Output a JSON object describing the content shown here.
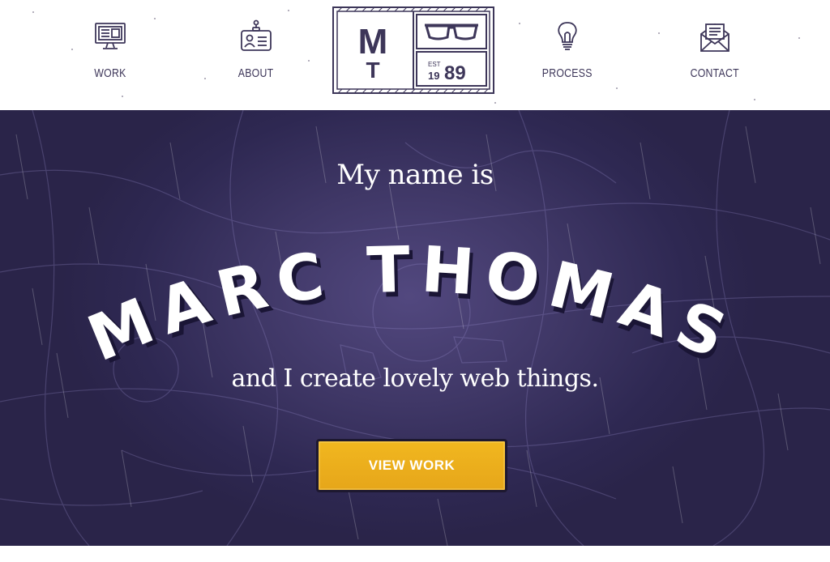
{
  "nav": {
    "items": [
      {
        "label": "WORK",
        "icon": "monitor-icon"
      },
      {
        "label": "ABOUT",
        "icon": "id-badge-icon"
      },
      {
        "label": "PROCESS",
        "icon": "lightbulb-icon"
      },
      {
        "label": "CONTACT",
        "icon": "envelope-icon"
      }
    ]
  },
  "logo": {
    "monogram": "MT",
    "est_label": "EST",
    "year_prefix": "19",
    "year_suffix": "89",
    "icon": "glasses-icon"
  },
  "hero": {
    "intro": "My name is",
    "name": "MARC THOMAS",
    "tagline": "and I create lovely web things.",
    "cta_label": "VIEW WORK"
  },
  "colors": {
    "brand_purple": "#3d3659",
    "hero_bg": "#2e2852",
    "cta_yellow": "#f1b71f",
    "text_white": "#ffffff"
  }
}
